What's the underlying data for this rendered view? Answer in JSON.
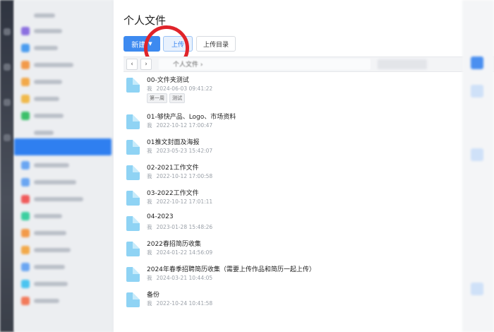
{
  "page": {
    "title": "个人文件"
  },
  "toolbar": {
    "new_label": "新建",
    "upload_label": "上传",
    "upload_dir_label": "上传目录"
  },
  "pathbar": {
    "back_icon": "chevron-left-icon",
    "forward_icon": "chevron-right-icon",
    "breadcrumb": "个人文件",
    "breadcrumb_sep": "›"
  },
  "files": [
    {
      "name": "00-文件夹测试",
      "owner": "我",
      "time": "2024-06-03 09:41:22",
      "tags": [
        "第一周",
        "测试"
      ]
    },
    {
      "name": "01-够快产品、Logo、市场资料",
      "owner": "我",
      "time": "2022-10-12 17:00:47",
      "tags": []
    },
    {
      "name": "01推文封面及海报",
      "owner": "我",
      "time": "2023-05-23 15:42:07",
      "tags": []
    },
    {
      "name": "02-2021工作文件",
      "owner": "我",
      "time": "2022-10-12 17:00:58",
      "tags": []
    },
    {
      "name": "03-2022工作文件",
      "owner": "我",
      "time": "2022-10-12 17:01:11",
      "tags": []
    },
    {
      "name": "04-2023",
      "owner": "我",
      "time": "2023-01-28 15:48:26",
      "tags": []
    },
    {
      "name": "2022春招简历收集",
      "owner": "我",
      "time": "2024-01-22 14:56:09",
      "tags": []
    },
    {
      "name": "2024年春季招聘简历收集（需要上传作品和简历一起上传）",
      "owner": "我",
      "time": "2024-03-21 10:44:05",
      "tags": []
    },
    {
      "name": "备份",
      "owner": "我",
      "time": "2022-10-24 10:41:58",
      "tags": []
    }
  ],
  "colors": {
    "accent": "#3d8af0",
    "annotation": "#e0232a",
    "folder": "#8fd3f4"
  }
}
